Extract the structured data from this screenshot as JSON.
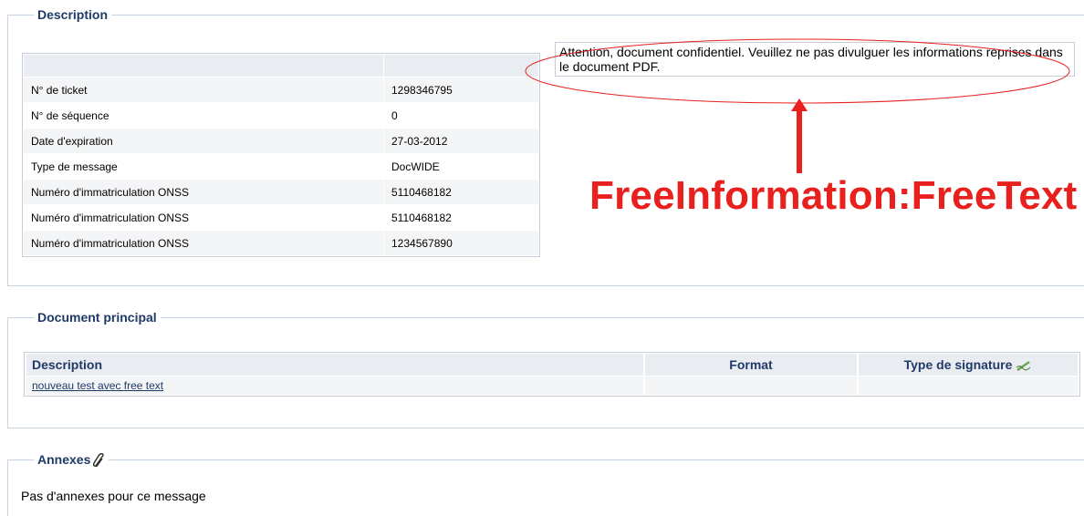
{
  "description_section": {
    "legend": "Description",
    "rows": [
      {
        "label": "N° de ticket",
        "value": "1298346795"
      },
      {
        "label": "N° de séquence",
        "value": "0"
      },
      {
        "label": "Date d'expiration",
        "value": "27-03-2012"
      },
      {
        "label": "Type de message",
        "value": "DocWIDE"
      },
      {
        "label": "Numéro d'immatriculation ONSS",
        "value": "5110468182"
      },
      {
        "label": "Numéro d'immatriculation ONSS",
        "value": "5110468182"
      },
      {
        "label": "Numéro d'immatriculation ONSS",
        "value": "1234567890"
      }
    ],
    "free_text": "Attention, document confidentiel. Veuillez ne pas divulguer les informations reprises dans le document PDF.",
    "annotation": "FreeInformation:FreeText",
    "annotation_color": "#e8201e"
  },
  "document_section": {
    "legend": "Document principal",
    "columns": {
      "description": "Description",
      "format": "Format",
      "signature": "Type de signature"
    },
    "rows": [
      {
        "description": "nouveau test avec free text",
        "format": "",
        "signature": ""
      }
    ]
  },
  "annex_section": {
    "legend": "Annexes",
    "empty_text": "Pas d'annexes pour ce message"
  },
  "colors": {
    "heading": "#1f3a68",
    "border": "#c7d5e2",
    "header_bg": "#e9ecf0"
  }
}
